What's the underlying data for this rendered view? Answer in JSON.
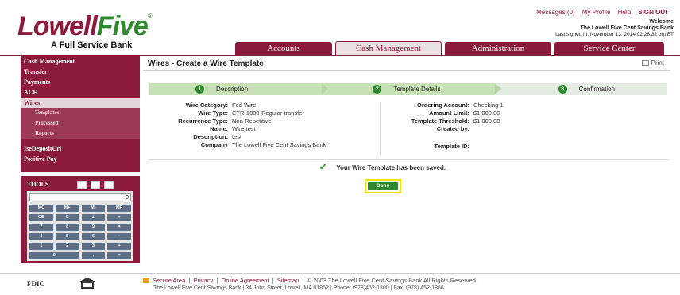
{
  "brand": {
    "logo_part1": "Lowell",
    "logo_part2": "Five",
    "logo_reg": "®",
    "tagline": "A Full Service Bank"
  },
  "topnav": {
    "messages": "Messages (0)",
    "profile": "My Profile",
    "help": "Help",
    "signout": "SIGN OUT"
  },
  "welcome": {
    "line1": "Welcome",
    "line2": "The Lowell Five Cent Savings Bank",
    "line3": "Last signed in: November 13, 2014 02:26:32 pm ET"
  },
  "tabs": [
    {
      "label": "Accounts"
    },
    {
      "label": "Cash Management"
    },
    {
      "label": "Administration"
    },
    {
      "label": "Service Center"
    }
  ],
  "sidebar": {
    "items": [
      {
        "label": "Cash Management"
      },
      {
        "label": "Transfer"
      },
      {
        "label": "Payments"
      },
      {
        "label": "ACH"
      },
      {
        "label": "Wires"
      }
    ],
    "subitems": [
      {
        "label": "- Templates"
      },
      {
        "label": "- Processed"
      },
      {
        "label": "- Reports"
      }
    ],
    "extra": [
      {
        "label": "IseDepositUrl"
      },
      {
        "label": "Positive Pay"
      }
    ]
  },
  "tools": {
    "label": "TOOLS",
    "display": "0",
    "keys": [
      "MC",
      "M+",
      "M-",
      "MR",
      "CE",
      "C",
      "±",
      "÷",
      "7",
      "8",
      "9",
      "×",
      "4",
      "5",
      "6",
      "−",
      "1",
      "2",
      "3",
      "+",
      "0",
      ".",
      "="
    ]
  },
  "main": {
    "title": "Wires - Create a Wire Template",
    "print": "Print"
  },
  "steps": [
    {
      "num": "1",
      "label": "Description"
    },
    {
      "num": "2",
      "label": "Template Details"
    },
    {
      "num": "3",
      "label": "Confirmation"
    }
  ],
  "details_left": [
    {
      "label": "Wire Category:",
      "value": "Fed Wire"
    },
    {
      "label": "Wire Type:",
      "value": "CTR-1000-Regular transfer"
    },
    {
      "label": "Recurrence Type:",
      "value": "Non-Repetitive"
    },
    {
      "label": "Name:",
      "value": "Wire test"
    },
    {
      "label": "Description:",
      "value": "test"
    },
    {
      "label": "Company",
      "value": "The Lowell Five Cent Savings Bank"
    }
  ],
  "details_right": [
    {
      "label": "Ordering Account:",
      "value": "Checking 1"
    },
    {
      "label": "Amount Limit:",
      "value": "$1,000.00"
    },
    {
      "label": "Template Threshold:",
      "value": "$1,000.00"
    },
    {
      "label": "Created by:",
      "value": ""
    },
    {
      "label": "Template ID:",
      "value": ""
    }
  ],
  "status": {
    "message": "Your Wire Template has been saved."
  },
  "actions": {
    "done": "Done"
  },
  "footer": {
    "links": [
      "Secure Area",
      "Privacy",
      "Online Agreement",
      "Sitemap"
    ],
    "copyright": "© 2003 The Lowell Five Cent Savings Bank All Rights Reserved.",
    "address": "The Lowell Five Cent Savings Bank   |   34 John Street, Lowell, MA 01852   |   Phone: (978)452-1300   |   Fax: (978) 452-1866",
    "fdic": "FDIC"
  },
  "colors": {
    "brand_maroon": "#8b1a3c",
    "brand_green": "#2f8a2f",
    "done_highlight": "#f2e400"
  }
}
